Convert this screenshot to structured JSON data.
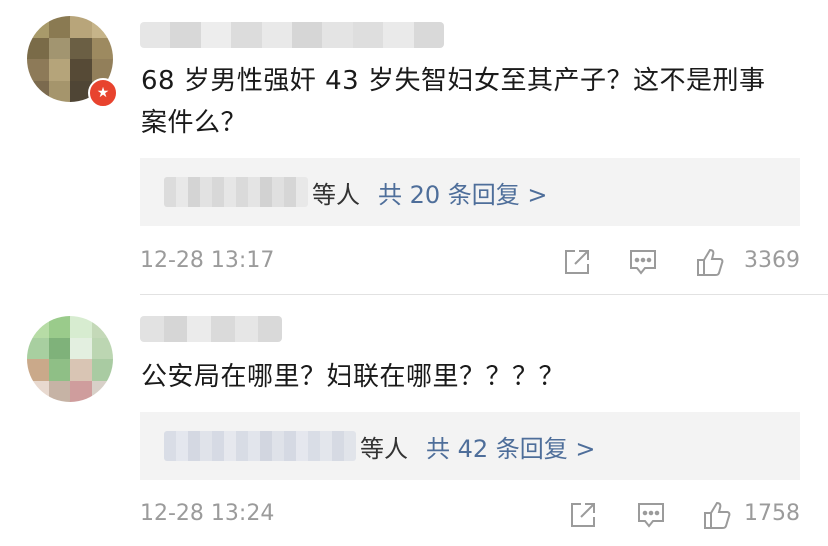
{
  "comments": [
    {
      "content": "68 岁男性强奸 43 岁失智妇女至其产子？这不是刑事案件么？",
      "reply_suffix": "等人",
      "reply_link": "共 20 条回复 >",
      "timestamp": "12-28 13:17",
      "like_count": "3369",
      "badge_icon": "verified-badge-icon",
      "avatar_colors": [
        "#a89a6a",
        "#8a7a52",
        "#b8a57a",
        "#c6b489",
        "#7a6b48",
        "#a29570",
        "#6b5f44",
        "#9d8a60",
        "#8d7a58",
        "#b5a47a",
        "#564a36",
        "#927f5a",
        "#7b6a4e",
        "#a5956c",
        "#4f4535",
        "#857556"
      ]
    },
    {
      "content": "公安局在哪里？妇联在哪里？？？？",
      "reply_suffix": "等人",
      "reply_link": "共 42 条回复 >",
      "timestamp": "12-28 13:24",
      "like_count": "1758",
      "avatar_colors": [
        "#b7dca6",
        "#9acb8b",
        "#d7ecd0",
        "#c4d9b8",
        "#a8cfa0",
        "#7fb27a",
        "#e3efe0",
        "#bcd6b2",
        "#caa98a",
        "#8fbf86",
        "#d9c5b4",
        "#a9cba2",
        "#e8d9cf",
        "#c6b3a5",
        "#cf9d9d",
        "#d8d0c8"
      ]
    }
  ],
  "accent_color": "#4e6e9a"
}
